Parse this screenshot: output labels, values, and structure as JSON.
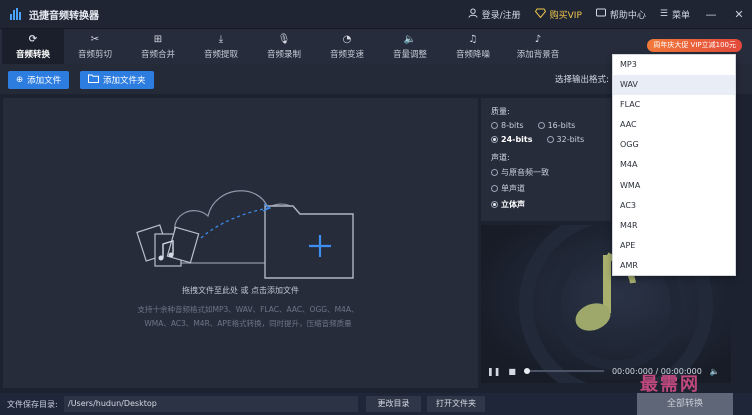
{
  "app": {
    "title": "迅捷音频转换器"
  },
  "title_bar": {
    "login": "登录/注册",
    "vip": "购买VIP",
    "help": "帮助中心",
    "menu": "菜单",
    "minimize": "—",
    "close": "✕"
  },
  "tabs": [
    {
      "label": "音频转换",
      "icon": "refresh-icon",
      "glyph": "⟳",
      "active": true
    },
    {
      "label": "音频剪切",
      "icon": "scissors-icon",
      "glyph": "✂",
      "active": false
    },
    {
      "label": "音频合并",
      "icon": "merge-icon",
      "glyph": "⊞",
      "active": false
    },
    {
      "label": "音频提取",
      "icon": "extract-icon",
      "glyph": "⤓",
      "active": false
    },
    {
      "label": "音频录制",
      "icon": "microphone-icon",
      "glyph": "🎙",
      "active": false
    },
    {
      "label": "音频变速",
      "icon": "speed-icon",
      "glyph": "◔",
      "active": false
    },
    {
      "label": "音量调整",
      "icon": "volume-icon",
      "glyph": "🔈",
      "active": false
    },
    {
      "label": "音频降噪",
      "icon": "noise-icon",
      "glyph": "♫",
      "active": false
    },
    {
      "label": "添加背景音",
      "icon": "music-note-icon",
      "glyph": "♪",
      "active": false
    }
  ],
  "promo": "周年庆大促 VIP立减100元",
  "actions": {
    "add_file": "添加文件",
    "add_folder": "添加文件夹",
    "output_format_label": "选择输出格式:"
  },
  "drop": {
    "hint": "拖拽文件至此处 或 点击添加文件",
    "desc_line1": "支持十余种音频格式如MP3、WAV、FLAC、AAC、OGG、M4A、",
    "desc_line2": "WMA、AC3、M4R、APE格式转换，同时提升，压缩音频质量"
  },
  "settings": {
    "quality_label": "质量:",
    "quality_options": [
      "8-bits",
      "16-bits",
      "24-bits",
      "32-bits"
    ],
    "quality_selected": "24-bits",
    "channel_label": "声道:",
    "channel_options": [
      "与原音频一致",
      "单声道",
      "立体声"
    ],
    "channel_selected": "立体声"
  },
  "player": {
    "time": "00:00:000 / 00:00:000"
  },
  "format_dropdown": {
    "options": [
      "MP3",
      "WAV",
      "FLAC",
      "AAC",
      "OGG",
      "M4A",
      "WMA",
      "AC3",
      "M4R",
      "APE",
      "AMR"
    ],
    "highlighted": "WAV"
  },
  "bottom": {
    "save_dir_label": "文件保存目录:",
    "save_dir_value": "/Users/hudun/Desktop",
    "change_dir": "更改目录",
    "open_folder": "打开文件夹",
    "convert_all": "全部转换"
  },
  "watermark": "最需网",
  "colors": {
    "accent": "#2d7de0",
    "background": "#1c2230",
    "panel": "#262c3a",
    "promo": "#e2493b",
    "note_green": "#9ea86a"
  }
}
